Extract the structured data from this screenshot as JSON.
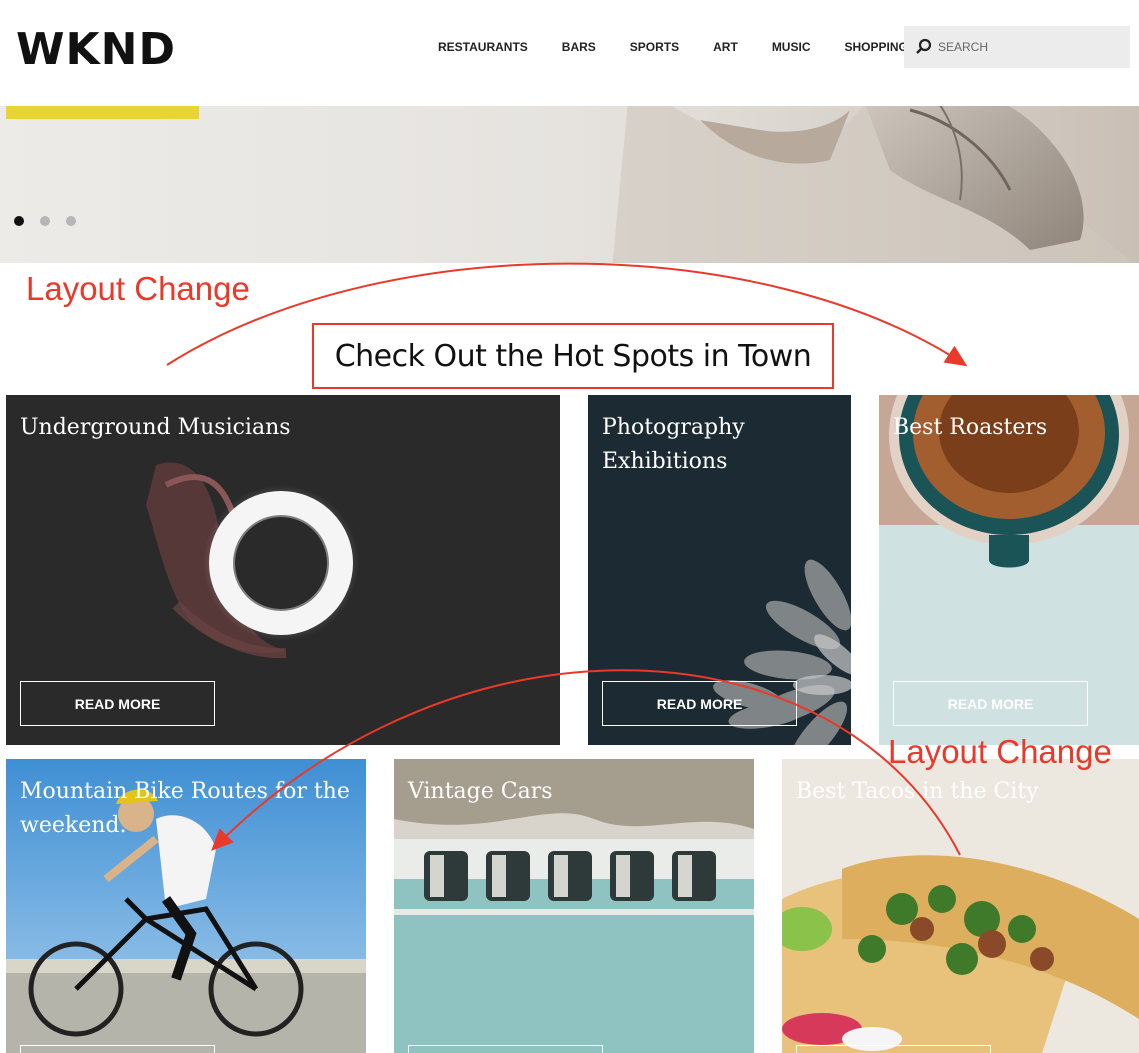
{
  "header": {
    "logo": "WKND",
    "nav": [
      "RESTAURANTS",
      "BARS",
      "SPORTS",
      "ART",
      "MUSIC",
      "SHOPPING"
    ],
    "search_placeholder": "SEARCH"
  },
  "hero": {
    "slides_count": 3,
    "active_slide": 1
  },
  "annotations": {
    "label_top": "Layout Change",
    "label_right": "Layout Change",
    "color": "#e8392a"
  },
  "section": {
    "title": "Check Out the Hot Spots in Town"
  },
  "cards": [
    {
      "title": "Underground Musicians",
      "button": "READ MORE"
    },
    {
      "title": "Photography Exhibitions",
      "button": "READ MORE"
    },
    {
      "title": "Best Roasters",
      "button": "READ MORE"
    },
    {
      "title": "Mountain Bike Routes for the weekend.",
      "button": ""
    },
    {
      "title": "Vintage Cars",
      "button": ""
    },
    {
      "title": "Best Tacos in the City",
      "button": ""
    }
  ]
}
